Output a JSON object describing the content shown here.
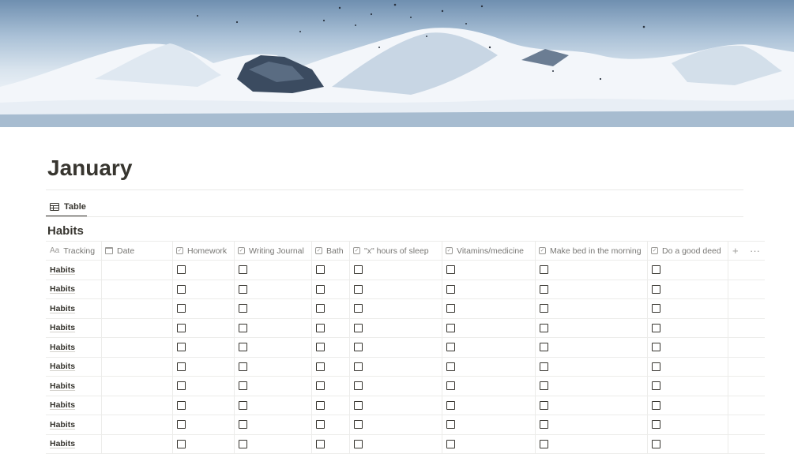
{
  "page": {
    "title": "January"
  },
  "cover": {
    "description_colors": {
      "sky": "#6f8fb0",
      "snow": "#eef3f8",
      "rock": "#3a4a5e"
    }
  },
  "view": {
    "tab_label": "Table",
    "tab_icon": "table-icon"
  },
  "database": {
    "title": "Habits",
    "columns": [
      {
        "label": "Tracking",
        "icon": "aa-text-icon"
      },
      {
        "label": "Date",
        "icon": "calendar-icon"
      },
      {
        "label": "Homework",
        "icon": "checkbox-icon"
      },
      {
        "label": "Writing Journal",
        "icon": "checkbox-icon"
      },
      {
        "label": "Bath",
        "icon": "checkbox-icon"
      },
      {
        "label": "\"x\" hours of sleep",
        "icon": "checkbox-icon"
      },
      {
        "label": "Vitamins/medicine",
        "icon": "checkbox-icon"
      },
      {
        "label": "Make bed in the morning",
        "icon": "checkbox-icon"
      },
      {
        "label": "Do a good deed",
        "icon": "checkbox-icon"
      }
    ],
    "add_column_icon": "+",
    "more_icon": "···",
    "text_icon": "Aa",
    "checkbox_glyph": "✓",
    "rows": [
      {
        "name": "Habits",
        "date": "",
        "checks": [
          false,
          false,
          false,
          false,
          false,
          false,
          false
        ]
      },
      {
        "name": "Habits",
        "date": "",
        "checks": [
          false,
          false,
          false,
          false,
          false,
          false,
          false
        ]
      },
      {
        "name": "Habits",
        "date": "",
        "checks": [
          false,
          false,
          false,
          false,
          false,
          false,
          false
        ]
      },
      {
        "name": "Habits",
        "date": "",
        "checks": [
          false,
          false,
          false,
          false,
          false,
          false,
          false
        ]
      },
      {
        "name": "Habits",
        "date": "",
        "checks": [
          false,
          false,
          false,
          false,
          false,
          false,
          false
        ]
      },
      {
        "name": "Habits",
        "date": "",
        "checks": [
          false,
          false,
          false,
          false,
          false,
          false,
          false
        ]
      },
      {
        "name": "Habits",
        "date": "",
        "checks": [
          false,
          false,
          false,
          false,
          false,
          false,
          false
        ]
      },
      {
        "name": "Habits",
        "date": "",
        "checks": [
          false,
          false,
          false,
          false,
          false,
          false,
          false
        ]
      },
      {
        "name": "Habits",
        "date": "",
        "checks": [
          false,
          false,
          false,
          false,
          false,
          false,
          false
        ]
      },
      {
        "name": "Habits",
        "date": "",
        "checks": [
          false,
          false,
          false,
          false,
          false,
          false,
          false
        ]
      }
    ]
  }
}
